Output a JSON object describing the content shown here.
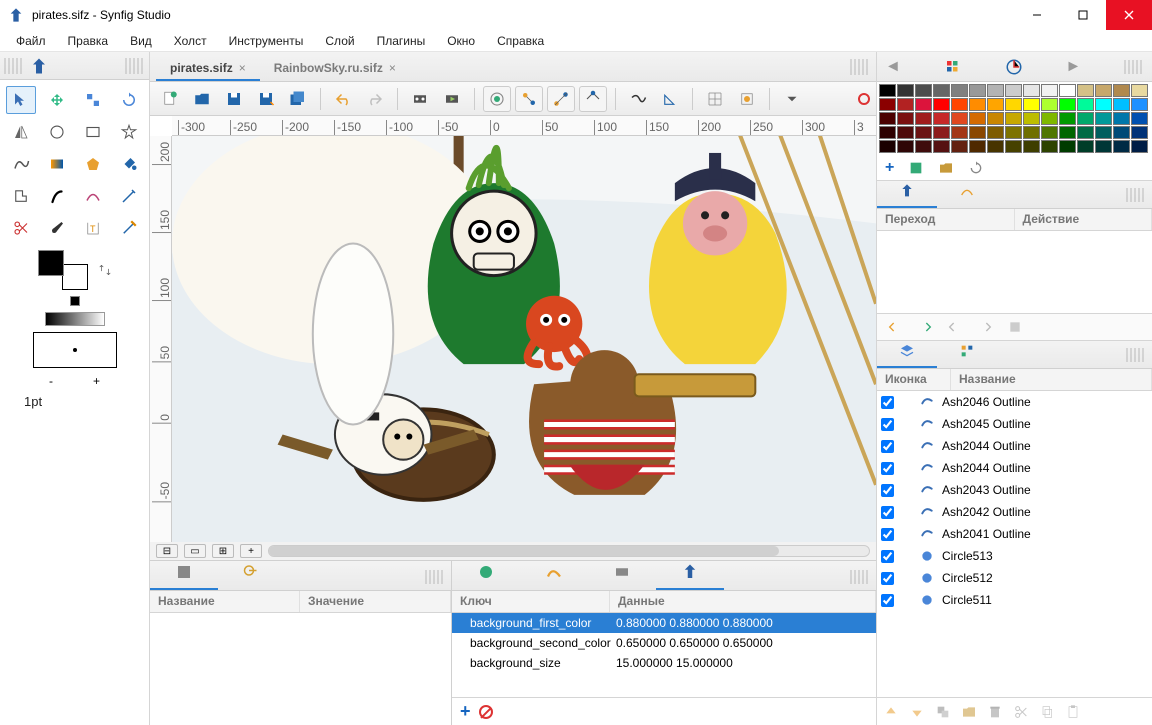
{
  "titlebar": {
    "title": "pirates.sifz - Synfig Studio"
  },
  "menu": [
    "Файл",
    "Правка",
    "Вид",
    "Холст",
    "Инструменты",
    "Слой",
    "Плагины",
    "Окно",
    "Справка"
  ],
  "toolbox": {
    "pt_label": "1pt",
    "minus": "-",
    "plus": "+"
  },
  "tabs": [
    {
      "label": "pirates.sifz",
      "active": true
    },
    {
      "label": "RainbowSky.ru.sifz",
      "active": false
    }
  ],
  "ruler_h": [
    "-300",
    "-250",
    "-200",
    "-150",
    "-100",
    "-50",
    "0",
    "50",
    "100",
    "150",
    "200",
    "250",
    "300",
    "3"
  ],
  "ruler_v": [
    "200",
    "150",
    "100",
    "50",
    "0",
    "-50"
  ],
  "bottom_left": {
    "cols": [
      "Название",
      "Значение"
    ]
  },
  "meta": {
    "cols": [
      "Ключ",
      "Данные"
    ],
    "rows": [
      {
        "k": "background_first_color",
        "v": "0.880000 0.880000 0.880000",
        "sel": true
      },
      {
        "k": "background_second_color",
        "v": "0.650000 0.650000 0.650000",
        "sel": false
      },
      {
        "k": "background_size",
        "v": "15.000000 15.000000",
        "sel": false
      }
    ]
  },
  "anim": {
    "cols": [
      "Переход",
      "Действие"
    ]
  },
  "layers": {
    "cols": [
      "Иконка",
      "Название"
    ],
    "rows": [
      {
        "name": "Ash2046 Outline",
        "type": "outline"
      },
      {
        "name": "Ash2045 Outline",
        "type": "outline"
      },
      {
        "name": "Ash2044 Outline",
        "type": "outline"
      },
      {
        "name": "Ash2044 Outline",
        "type": "outline"
      },
      {
        "name": "Ash2043 Outline",
        "type": "outline"
      },
      {
        "name": "Ash2042 Outline",
        "type": "outline"
      },
      {
        "name": "Ash2041 Outline",
        "type": "outline"
      },
      {
        "name": "Circle513",
        "type": "circle"
      },
      {
        "name": "Circle512",
        "type": "circle"
      },
      {
        "name": "Circle511",
        "type": "circle"
      }
    ]
  },
  "palette": [
    "#000000",
    "#333333",
    "#4d4d4d",
    "#666666",
    "#808080",
    "#999999",
    "#b3b3b3",
    "#cccccc",
    "#e6e6e6",
    "#f2f2f2",
    "#ffffff",
    "#d4c187",
    "#c7a86b",
    "#b0894e",
    "#e8d9a0",
    "#8b0000",
    "#b22222",
    "#dc143c",
    "#ff0000",
    "#ff4500",
    "#ff8c00",
    "#ffa500",
    "#ffd700",
    "#ffff00",
    "#adff2f",
    "#00ff00",
    "#00fa9a",
    "#00ffff",
    "#00bfff",
    "#1e90ff",
    "#4b0000",
    "#7a1010",
    "#a01c1c",
    "#c62828",
    "#e04820",
    "#d46a00",
    "#c98600",
    "#c7a800",
    "#bdbd00",
    "#7fb800",
    "#009a00",
    "#00a86b",
    "#009999",
    "#0077aa",
    "#0050b0",
    "#2e0000",
    "#4e0a0a",
    "#6b1313",
    "#8c1c1c",
    "#a33616",
    "#8a4700",
    "#7e5c00",
    "#7d7300",
    "#6f6f00",
    "#4f7600",
    "#006600",
    "#006b45",
    "#005f5f",
    "#004a77",
    "#003278",
    "#1a0000",
    "#2e0606",
    "#3f0c0c",
    "#551111",
    "#632110",
    "#4f2900",
    "#473400",
    "#464100",
    "#3e3e00",
    "#2d4300",
    "#003b00",
    "#003d28",
    "#003636",
    "#002a44",
    "#001d45"
  ]
}
